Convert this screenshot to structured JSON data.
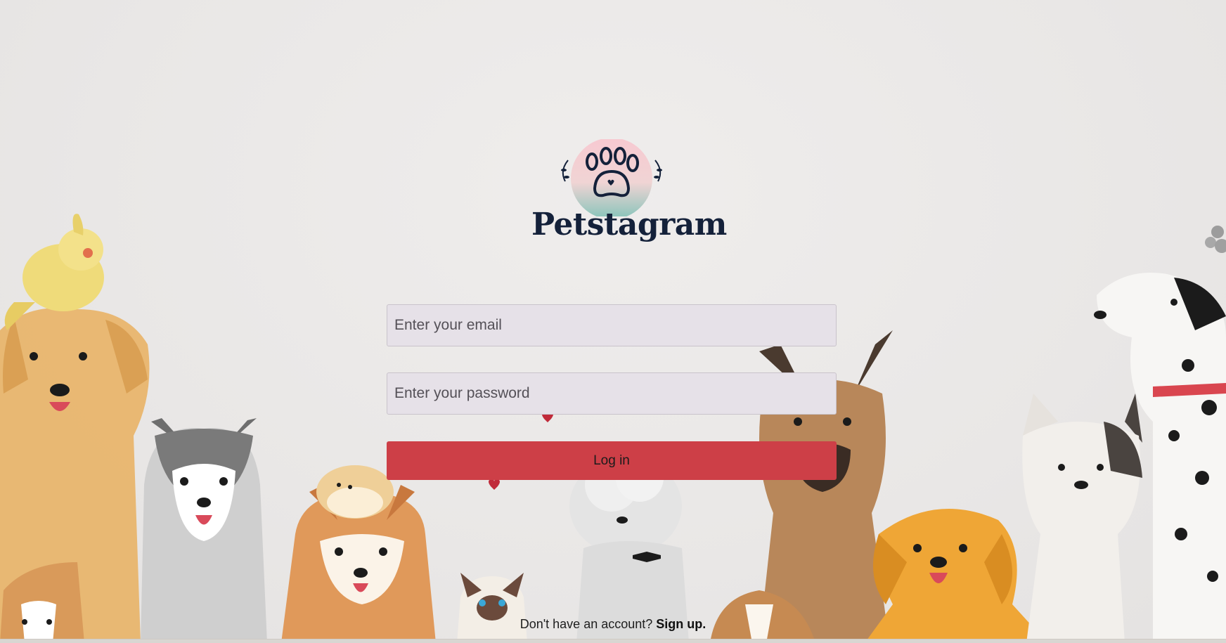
{
  "brand": {
    "name": "Petstagram",
    "logo_icon": "paw-icon",
    "colors": {
      "navy": "#14213a",
      "pink": "#f6c9d0",
      "teal": "#8cc7be"
    }
  },
  "form": {
    "email": {
      "placeholder": "Enter your email",
      "value": ""
    },
    "password": {
      "placeholder": "Enter your password",
      "value": ""
    },
    "login_label": "Log in"
  },
  "footer": {
    "prompt": "Don't have an account?",
    "signup_label": "Sign up."
  },
  "theme": {
    "accent": "#cd3f47",
    "input_bg": "#e6e1e8",
    "page_bg": "#ebe9e8"
  },
  "background": {
    "illustration": "watercolor pets group",
    "icons": [
      "cockatiel-icon",
      "golden-retriever-icon",
      "husky-icon",
      "shiba-inu-icon",
      "hamster-icon",
      "siamese-cat-icon",
      "poodle-icon",
      "german-shepherd-icon",
      "golden-dog-icon",
      "french-bulldog-icon",
      "dalmatian-icon",
      "corgi-icon",
      "beagle-icon",
      "heart-icon",
      "paw-print-icon"
    ]
  }
}
